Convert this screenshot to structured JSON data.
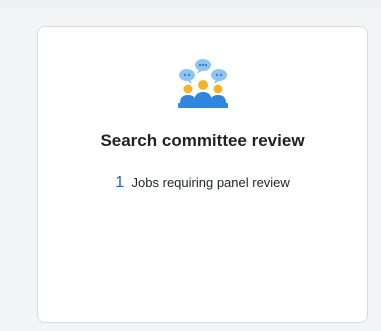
{
  "card": {
    "title": "Search committee review",
    "jobs_count": "1",
    "jobs_label": "Jobs requiring panel review",
    "icon": "panel-review-people-icon",
    "colors": {
      "accent": "#1d5fd1",
      "bubble": "#8fc4f2",
      "person_gold": "#f3b429",
      "person_blue": "#2f86e0"
    }
  }
}
